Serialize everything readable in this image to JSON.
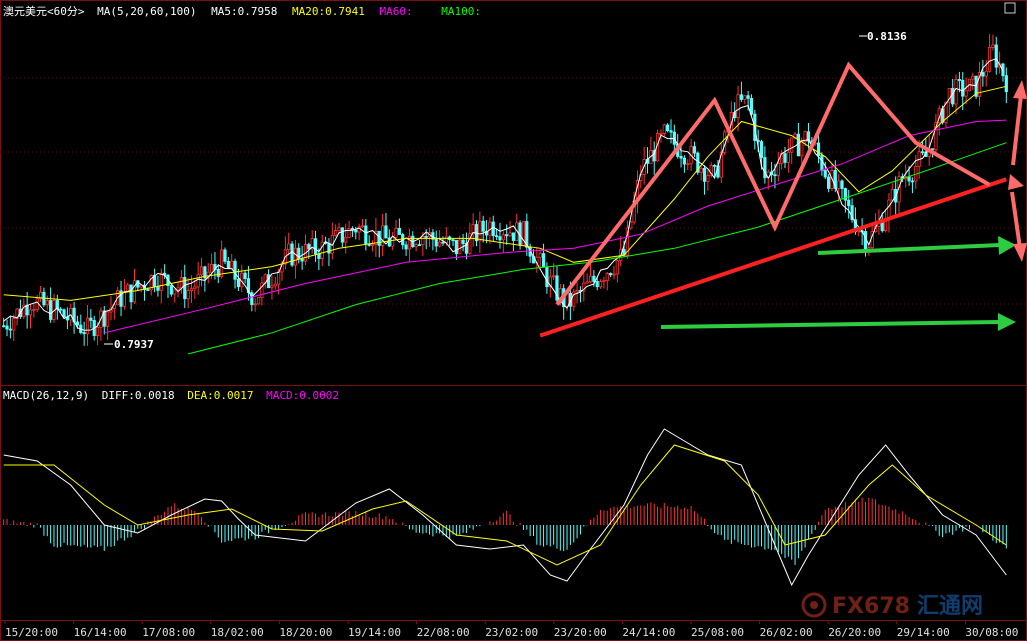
{
  "chart_data": [
    {
      "type": "line",
      "title": "澳元美元<60分>",
      "indicator_label": "MA(5,20,60,100)",
      "legend": [
        {
          "name": "MA5",
          "value": "0.7958",
          "color": "#ffffff"
        },
        {
          "name": "MA20",
          "value": "0.7941",
          "color": "#ffff00"
        },
        {
          "name": "MA60",
          "value": "",
          "color": "#ff00ff"
        },
        {
          "name": "MA100",
          "value": "",
          "color": "#00ff00"
        }
      ],
      "annotations": [
        {
          "text": "0.7937",
          "kind": "low"
        },
        {
          "text": "0.8136",
          "kind": "high"
        }
      ],
      "x_labels": [
        "15/20:00",
        "16/14:00",
        "17/08:00",
        "18/02:00",
        "18/20:00",
        "19/14:00",
        "22/08:00",
        "23/02:00",
        "23/20:00",
        "24/14:00",
        "25/08:00",
        "26/02:00",
        "26/20:00",
        "29/14:00",
        "30/08:00"
      ],
      "price_path": [
        [
          0,
          0.794
        ],
        [
          8,
          0.7958
        ],
        [
          16,
          0.795
        ],
        [
          25,
          0.7937
        ],
        [
          35,
          0.796
        ],
        [
          45,
          0.7975
        ],
        [
          55,
          0.7965
        ],
        [
          65,
          0.7985
        ],
        [
          75,
          0.796
        ],
        [
          85,
          0.799
        ],
        [
          95,
          0.7995
        ],
        [
          105,
          0.801
        ],
        [
          115,
          0.8
        ],
        [
          125,
          0.8005
        ],
        [
          135,
          0.7995
        ],
        [
          145,
          0.8012
        ],
        [
          155,
          0.8005
        ],
        [
          163,
          0.797
        ],
        [
          168,
          0.7955
        ],
        [
          175,
          0.797
        ],
        [
          185,
          0.799
        ],
        [
          190,
          0.805
        ],
        [
          197,
          0.8075
        ],
        [
          205,
          0.806
        ],
        [
          212,
          0.8045
        ],
        [
          218,
          0.8095
        ],
        [
          222,
          0.81
        ],
        [
          227,
          0.8045
        ],
        [
          232,
          0.806
        ],
        [
          240,
          0.8075
        ],
        [
          245,
          0.805
        ],
        [
          250,
          0.803
        ],
        [
          255,
          0.801
        ],
        [
          258,
          0.8
        ],
        [
          263,
          0.802
        ],
        [
          268,
          0.8045
        ],
        [
          275,
          0.806
        ],
        [
          282,
          0.8105
        ],
        [
          290,
          0.811
        ],
        [
          295,
          0.8135
        ],
        [
          299,
          0.8115
        ]
      ],
      "ma20_path": [
        [
          0,
          0.7962
        ],
        [
          20,
          0.7958
        ],
        [
          40,
          0.7965
        ],
        [
          60,
          0.7975
        ],
        [
          80,
          0.7982
        ],
        [
          100,
          0.7995
        ],
        [
          120,
          0.8002
        ],
        [
          140,
          0.8002
        ],
        [
          160,
          0.7995
        ],
        [
          170,
          0.7985
        ],
        [
          185,
          0.799
        ],
        [
          200,
          0.803
        ],
        [
          210,
          0.806
        ],
        [
          220,
          0.8085
        ],
        [
          235,
          0.8075
        ],
        [
          245,
          0.806
        ],
        [
          255,
          0.8035
        ],
        [
          265,
          0.805
        ],
        [
          280,
          0.8085
        ],
        [
          290,
          0.8105
        ],
        [
          299,
          0.811
        ]
      ],
      "ma60_path": [
        [
          30,
          0.7935
        ],
        [
          60,
          0.7952
        ],
        [
          90,
          0.797
        ],
        [
          120,
          0.7985
        ],
        [
          150,
          0.7992
        ],
        [
          170,
          0.7995
        ],
        [
          190,
          0.8005
        ],
        [
          210,
          0.8025
        ],
        [
          230,
          0.804
        ],
        [
          250,
          0.8055
        ],
        [
          270,
          0.8075
        ],
        [
          290,
          0.8085
        ],
        [
          299,
          0.8086
        ]
      ],
      "ma100_path": [
        [
          55,
          0.792
        ],
        [
          80,
          0.7935
        ],
        [
          105,
          0.7955
        ],
        [
          130,
          0.797
        ],
        [
          155,
          0.798
        ],
        [
          175,
          0.7985
        ],
        [
          200,
          0.7995
        ],
        [
          225,
          0.801
        ],
        [
          250,
          0.803
        ],
        [
          275,
          0.805
        ],
        [
          299,
          0.807
        ]
      ],
      "trend_lines": [
        {
          "color": "#ff2020",
          "points": [
            [
              160,
              0.7933
            ],
            [
              299,
              0.8044
            ]
          ]
        },
        {
          "color": "#ff6a6a",
          "points": [
            [
              165,
              0.7955
            ],
            [
              212,
              0.81
            ],
            [
              230,
              0.801
            ],
            [
              252,
              0.8125
            ],
            [
              272,
              0.807
            ],
            [
              294,
              0.804
            ]
          ]
        }
      ],
      "ylim": [
        0.7905,
        0.815
      ]
    },
    {
      "type": "bar",
      "title": "MACD(26,12,9)",
      "legend": [
        {
          "name": "DIFF",
          "value": "0.0018",
          "color": "#ffffff"
        },
        {
          "name": "DEA",
          "value": "0.0017",
          "color": "#ffff00"
        },
        {
          "name": "MACD",
          "value": "0.0002",
          "color": "#ff00ff"
        }
      ],
      "diff_path": [
        [
          0,
          0.0035
        ],
        [
          10,
          0.0032
        ],
        [
          20,
          0.002
        ],
        [
          30,
          0.0
        ],
        [
          40,
          -0.0004
        ],
        [
          50,
          0.0005
        ],
        [
          60,
          0.0013
        ],
        [
          65,
          0.0012
        ],
        [
          70,
          0.0003
        ],
        [
          75,
          -0.0005
        ],
        [
          90,
          -0.0008
        ],
        [
          105,
          0.0011
        ],
        [
          115,
          0.0018
        ],
        [
          125,
          0.0005
        ],
        [
          135,
          -0.001
        ],
        [
          145,
          -0.0012
        ],
        [
          155,
          -0.001
        ],
        [
          163,
          -0.0025
        ],
        [
          168,
          -0.0028
        ],
        [
          175,
          -0.0012
        ],
        [
          185,
          0.001
        ],
        [
          192,
          0.0035
        ],
        [
          197,
          0.0048
        ],
        [
          205,
          0.004
        ],
        [
          210,
          0.0035
        ],
        [
          220,
          0.003
        ],
        [
          230,
          -0.001
        ],
        [
          235,
          -0.003
        ],
        [
          240,
          -0.0015
        ],
        [
          255,
          0.0025
        ],
        [
          263,
          0.004
        ],
        [
          270,
          0.0025
        ],
        [
          280,
          0.0005
        ],
        [
          290,
          -0.0005
        ],
        [
          299,
          -0.0025
        ]
      ],
      "dea_path": [
        [
          0,
          0.003
        ],
        [
          15,
          0.003
        ],
        [
          30,
          0.001
        ],
        [
          40,
          0.0
        ],
        [
          55,
          0.0005
        ],
        [
          68,
          0.0008
        ],
        [
          80,
          -0.0002
        ],
        [
          95,
          -0.0003
        ],
        [
          110,
          0.0008
        ],
        [
          120,
          0.0012
        ],
        [
          135,
          -0.0005
        ],
        [
          150,
          -0.0008
        ],
        [
          165,
          -0.002
        ],
        [
          178,
          -0.001
        ],
        [
          190,
          0.002
        ],
        [
          200,
          0.004
        ],
        [
          215,
          0.0032
        ],
        [
          225,
          0.0015
        ],
        [
          233,
          -0.001
        ],
        [
          245,
          -0.0005
        ],
        [
          258,
          0.002
        ],
        [
          265,
          0.003
        ],
        [
          275,
          0.0015
        ],
        [
          290,
          0.0
        ],
        [
          299,
          -0.001
        ]
      ],
      "hist_path": [
        [
          0,
          0.0002
        ],
        [
          10,
          0.0
        ],
        [
          15,
          -0.001
        ],
        [
          30,
          -0.0012
        ],
        [
          40,
          -0.0003
        ],
        [
          50,
          0.001
        ],
        [
          58,
          0.0007
        ],
        [
          65,
          -0.0008
        ],
        [
          75,
          -0.0006
        ],
        [
          90,
          0.0005
        ],
        [
          105,
          0.0006
        ],
        [
          115,
          0.0004
        ],
        [
          122,
          -0.0003
        ],
        [
          135,
          -0.0006
        ],
        [
          150,
          0.0006
        ],
        [
          160,
          -0.001
        ],
        [
          168,
          -0.0012
        ],
        [
          178,
          0.0008
        ],
        [
          190,
          0.001
        ],
        [
          205,
          0.0009
        ],
        [
          215,
          -0.0008
        ],
        [
          230,
          -0.0012
        ],
        [
          236,
          -0.002
        ],
        [
          245,
          0.0008
        ],
        [
          258,
          0.0013
        ],
        [
          270,
          0.0005
        ],
        [
          280,
          -0.0005
        ],
        [
          290,
          0.0
        ],
        [
          299,
          -0.0012
        ]
      ],
      "ylim": [
        -0.0045,
        0.006
      ]
    }
  ],
  "watermark": {
    "brand": "FX678",
    "cn": "汇通网"
  }
}
